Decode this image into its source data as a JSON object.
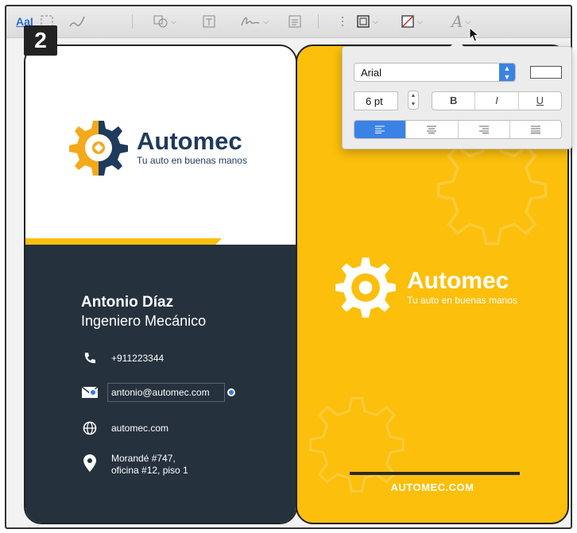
{
  "step": {
    "number": "2"
  },
  "toolbar": {
    "text_tool_label": "AaI",
    "font_icon_label": "A"
  },
  "front": {
    "brand_name": "Automec",
    "tagline": "Tu auto en buenas manos",
    "person_name": "Antonio Díaz",
    "person_title": "Ingeniero Mecánico",
    "phone": "+911223344",
    "email": "antonio@automec.com",
    "website": "automec.com",
    "address_line1": "Morandé #747,",
    "address_line2": "oficina #12, piso 1"
  },
  "back": {
    "brand_name": "Automec",
    "tagline": "Tu auto en buenas manos",
    "url": "AUTOMEC.COM"
  },
  "font_popover": {
    "font_family": "Arial",
    "font_size": "6 pt",
    "bold_label": "B",
    "italic_label": "I",
    "underline_label": "U",
    "text_color": "#ffffff"
  },
  "colors": {
    "brand_yellow": "#fbbf0c",
    "brand_navy": "#1f3a5c",
    "card_dark": "#25313d",
    "selection_blue": "#2f7ce0"
  }
}
